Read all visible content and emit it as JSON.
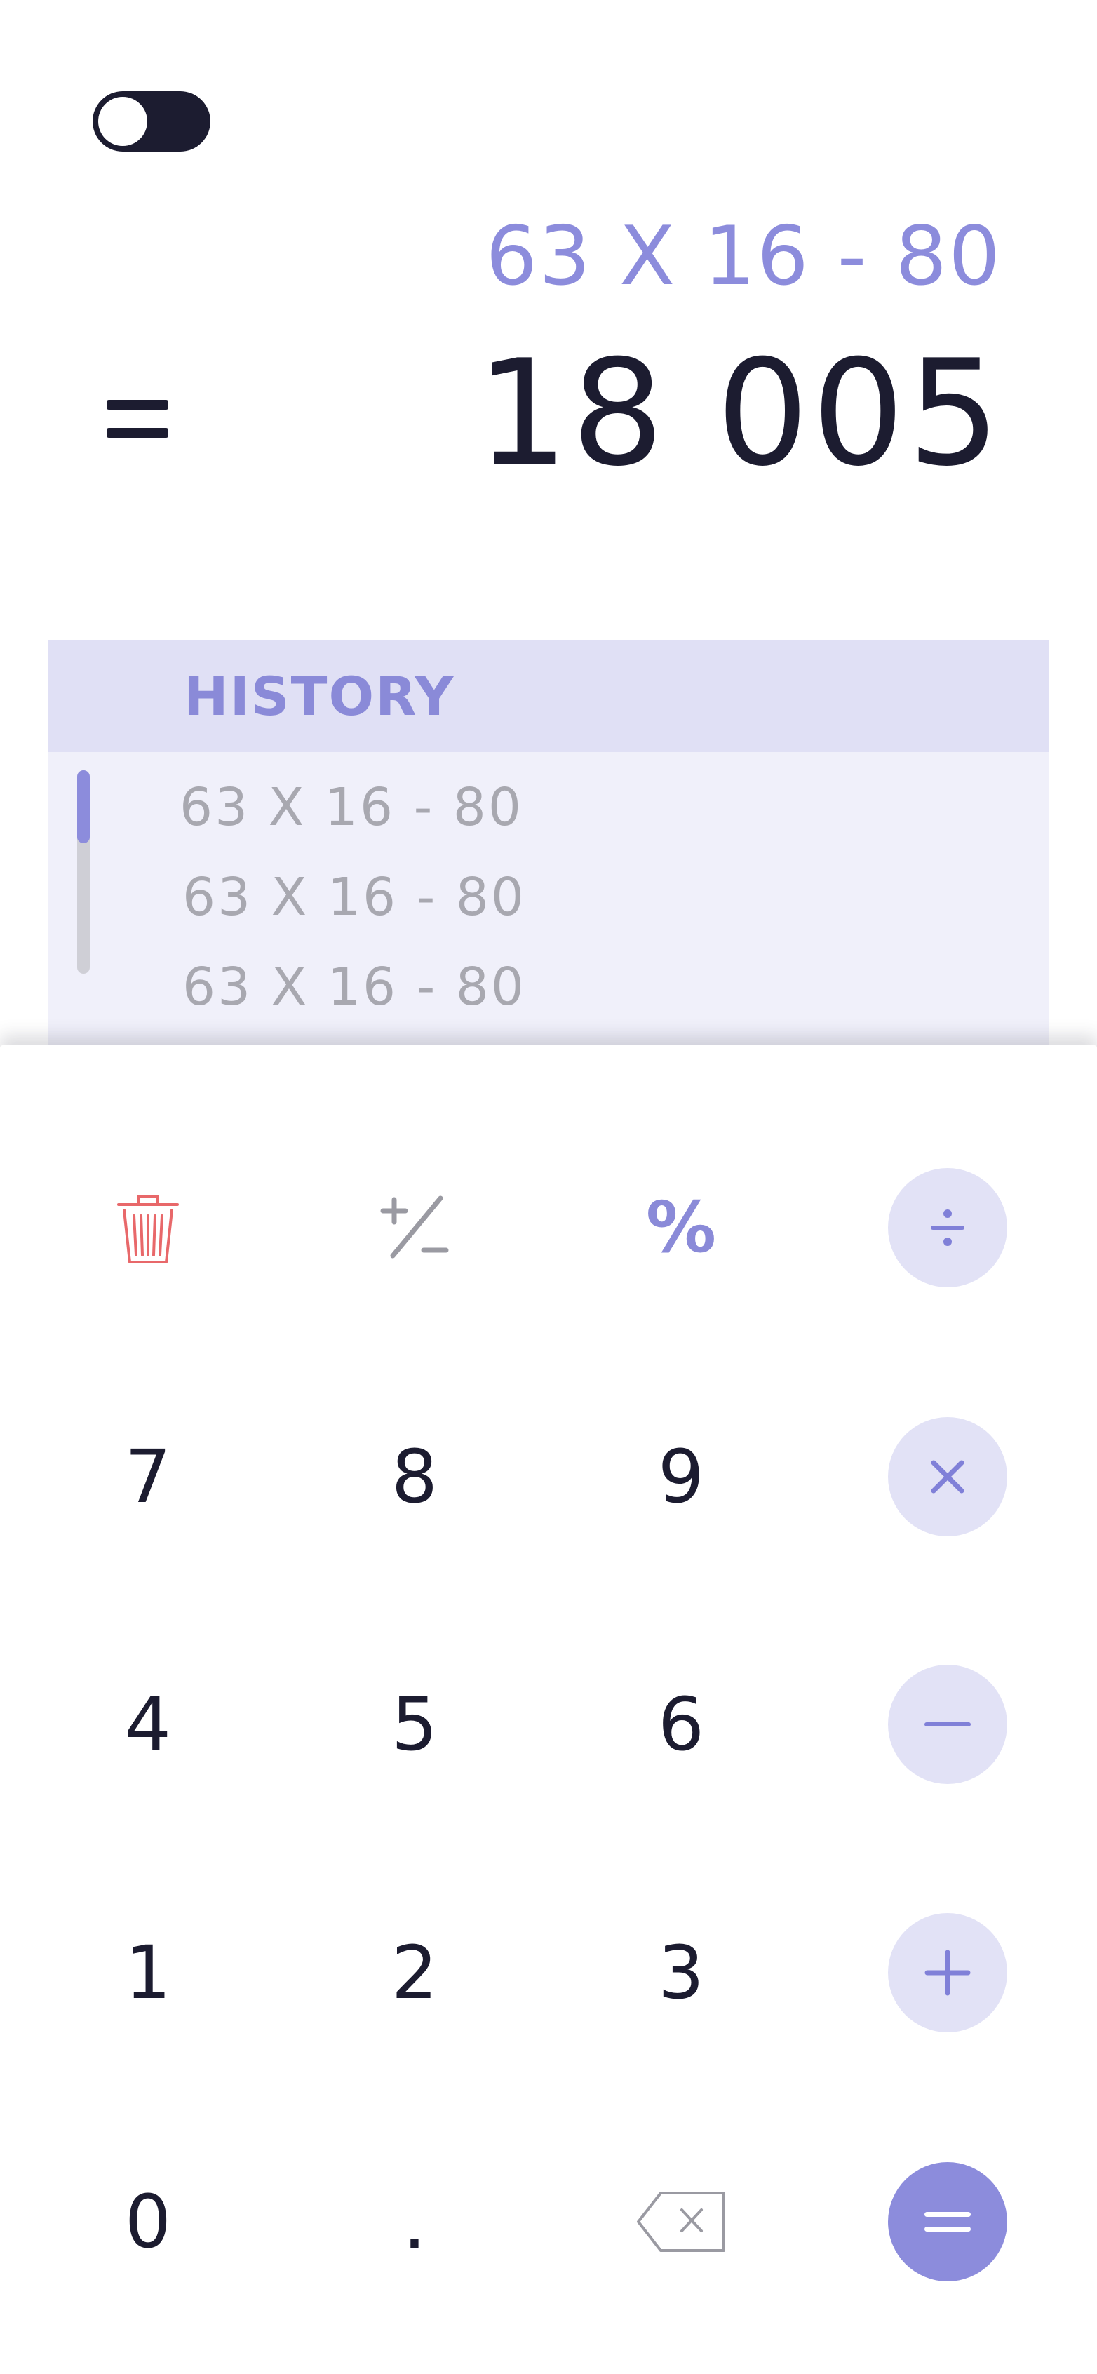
{
  "theme_toggle": {
    "state": "off",
    "icon": "toggle-switch"
  },
  "display": {
    "expression": "63 X 16 - 80",
    "result": "18 005",
    "equals_icon": "equals-icon"
  },
  "history": {
    "title": "HISTORY",
    "items": [
      "63 X 16 - 80",
      "63 X 16 - 80",
      "63 X 16 - 80"
    ]
  },
  "keypad": {
    "row1": {
      "clear_icon": "trash-icon",
      "sign_icon": "plus-minus-icon",
      "percent": "%",
      "divide_icon": "divide-icon"
    },
    "row2": {
      "k1": "7",
      "k2": "8",
      "k3": "9",
      "op_icon": "multiply-icon"
    },
    "row3": {
      "k1": "4",
      "k2": "5",
      "k3": "6",
      "op_icon": "minus-icon"
    },
    "row4": {
      "k1": "1",
      "k2": "2",
      "k3": "3",
      "op_icon": "plus-icon"
    },
    "row5": {
      "k1": "0",
      "k2": ".",
      "backspace_icon": "backspace-icon",
      "equals_icon": "equals-icon"
    }
  },
  "colors": {
    "accent": "#8c8cdc",
    "dark": "#1c1c30",
    "operator_bg": "#e2e2f6",
    "history_header_bg": "#e0e0f5",
    "history_bg": "#f0f0fa",
    "delete_red": "#e8686a"
  }
}
